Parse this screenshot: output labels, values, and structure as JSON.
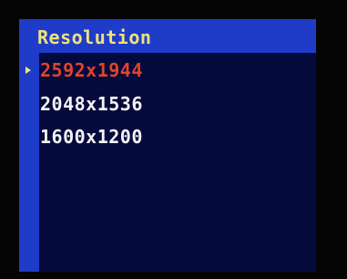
{
  "menu": {
    "title": "Resolution",
    "items": [
      {
        "label": "2592x1944",
        "selected": true
      },
      {
        "label": "2048x1536",
        "selected": false
      },
      {
        "label": "1600x1200",
        "selected": false
      }
    ],
    "cursor_icon": "triangle-right-icon"
  },
  "colors": {
    "background": "#040404",
    "panel": "#050a3c",
    "accent_bar": "#1f3cc8",
    "title_text": "#f0e27a",
    "item_text": "#f4f4f4",
    "selected_text": "#e0442a",
    "cursor": "#f5e27c"
  }
}
